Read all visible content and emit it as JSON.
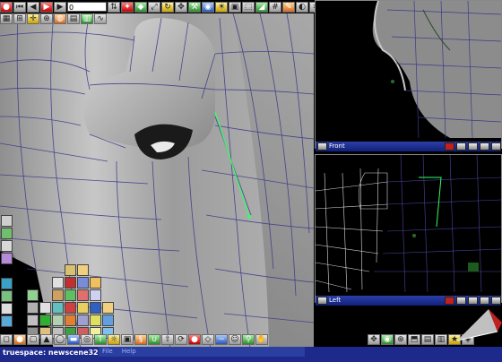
{
  "app": {
    "title": "truespace: newscene32"
  },
  "toolbar": {
    "frame_value": "0",
    "icons": [
      "red-circle-icon",
      "reset-icon",
      "prev-frame-icon",
      "play-icon",
      "next-frame-icon",
      "frame-input",
      "spin-icon",
      "select-icon",
      "object-tool-icon",
      "scale-icon",
      "rotate-icon",
      "move-icon",
      "tool-icon",
      "render-icon",
      "light-icon",
      "camera-icon",
      "sweep-icon",
      "bevel-icon",
      "mesh-icon",
      "paint-icon",
      "view-icon",
      "wire-icon",
      "undo-icon",
      "redo-icon"
    ]
  },
  "viewports": {
    "front": {
      "label": "Front"
    },
    "left": {
      "label": "Left"
    }
  },
  "menu": {
    "file_label": "File",
    "help_label": "Help"
  },
  "colors": {
    "title_bar": "#1a2f9a",
    "close_button": "#c02020",
    "selected_edge": "#33ff66",
    "wire": "#5a50a8"
  }
}
